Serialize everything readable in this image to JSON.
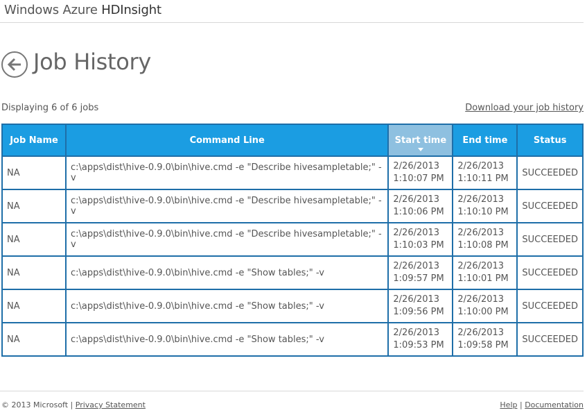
{
  "header": {
    "brand_prefix": "Windows Azure ",
    "brand_strong": "HDInsight"
  },
  "page": {
    "title": "Job History"
  },
  "summary": {
    "count_text": "Displaying 6 of 6 jobs",
    "download_link": "Download your job history"
  },
  "table": {
    "columns": [
      "Job Name",
      "Command Line",
      "Start time",
      "End time",
      "Status"
    ],
    "sorted_column": "Start time",
    "rows": [
      {
        "job_name": "NA",
        "command": "c:\\apps\\dist\\hive-0.9.0\\bin\\hive.cmd -e \"Describe hivesampletable;\" -v",
        "start_date": "2/26/2013",
        "start_time": "1:10:07 PM",
        "end_date": "2/26/2013",
        "end_time": "1:10:11 PM",
        "status": "SUCCEEDED"
      },
      {
        "job_name": "NA",
        "command": "c:\\apps\\dist\\hive-0.9.0\\bin\\hive.cmd -e \"Describe hivesampletable;\" -v",
        "start_date": "2/26/2013",
        "start_time": "1:10:06 PM",
        "end_date": "2/26/2013",
        "end_time": "1:10:10 PM",
        "status": "SUCCEEDED"
      },
      {
        "job_name": "NA",
        "command": "c:\\apps\\dist\\hive-0.9.0\\bin\\hive.cmd -e \"Describe hivesampletable;\" -v",
        "start_date": "2/26/2013",
        "start_time": "1:10:03 PM",
        "end_date": "2/26/2013",
        "end_time": "1:10:08 PM",
        "status": "SUCCEEDED"
      },
      {
        "job_name": "NA",
        "command": "c:\\apps\\dist\\hive-0.9.0\\bin\\hive.cmd -e \"Show tables;\" -v",
        "start_date": "2/26/2013",
        "start_time": "1:09:57 PM",
        "end_date": "2/26/2013",
        "end_time": "1:10:01 PM",
        "status": "SUCCEEDED"
      },
      {
        "job_name": "NA",
        "command": "c:\\apps\\dist\\hive-0.9.0\\bin\\hive.cmd -e \"Show tables;\" -v",
        "start_date": "2/26/2013",
        "start_time": "1:09:56 PM",
        "end_date": "2/26/2013",
        "end_time": "1:10:00 PM",
        "status": "SUCCEEDED"
      },
      {
        "job_name": "NA",
        "command": "c:\\apps\\dist\\hive-0.9.0\\bin\\hive.cmd -e \"Show tables;\" -v",
        "start_date": "2/26/2013",
        "start_time": "1:09:53 PM",
        "end_date": "2/26/2013",
        "end_time": "1:09:58 PM",
        "status": "SUCCEEDED"
      }
    ]
  },
  "footer": {
    "copyright": "© 2013 Microsoft | ",
    "privacy": "Privacy Statement",
    "help": "Help",
    "separator": " | ",
    "documentation": "Documentation"
  },
  "icons": {
    "back": "back-arrow-circle-icon",
    "sort": "sort-descending-icon"
  },
  "colors": {
    "header_bg": "#1b9de2",
    "sorted_header_bg": "#8ec0e0",
    "grid_border": "#1e6ea8"
  }
}
